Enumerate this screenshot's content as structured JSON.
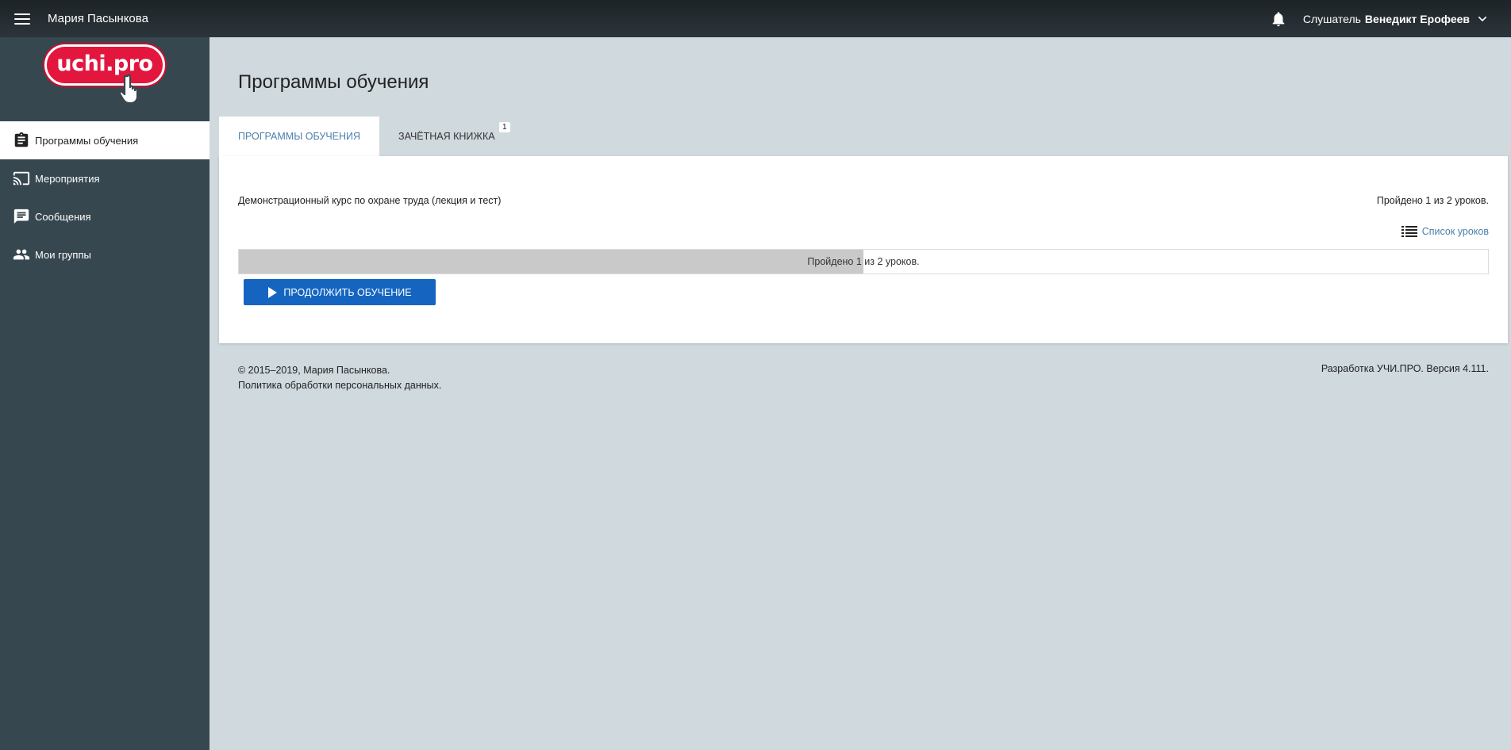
{
  "topbar": {
    "title": "Мария Пасынкова",
    "user_role": "Слушатель",
    "user_name": "Венедикт Ерофеев",
    "menu_icon": "hamburger-menu-icon",
    "notification_icon": "bell-icon",
    "dropdown_icon": "chevron-down-icon"
  },
  "logo": {
    "text": "uchi.pro"
  },
  "sidebar": {
    "items": [
      {
        "label": "Программы обучения",
        "icon": "clipboard-icon",
        "active": true
      },
      {
        "label": "Мероприятия",
        "icon": "cast-icon",
        "active": false
      },
      {
        "label": "Сообщения",
        "icon": "message-icon",
        "active": false
      },
      {
        "label": "Мои группы",
        "icon": "people-icon",
        "active": false
      }
    ]
  },
  "main": {
    "title": "Программы обучения",
    "tabs": [
      {
        "label": "Программы обучения",
        "active": true
      },
      {
        "label": "Зачётная книжка",
        "badge": "1",
        "active": false
      }
    ],
    "course": {
      "title": "Демонстрационный курс по охране труда (лекция и тест)",
      "progress_text": "Пройдено 1 из 2 уроков.",
      "lessons_link": "Список уроков",
      "progress_label": "Пройдено 1 из 2 уроков.",
      "progress_fraction": 0.5,
      "continue_button": "Продолжить обучение"
    }
  },
  "footer": {
    "copyright": "©  2015–2019, Мария Пасынкова.",
    "privacy": "Политика обработки персональных данных.",
    "developer": "Разработка УЧИ.ПРО. Версия 4.111."
  },
  "colors": {
    "topbar": "#1d2327",
    "sidebar": "#37474f",
    "background": "#cfd9de",
    "accent_blue": "#1565c0",
    "link_blue": "#4a7fad",
    "logo_red": "#e3173e"
  }
}
